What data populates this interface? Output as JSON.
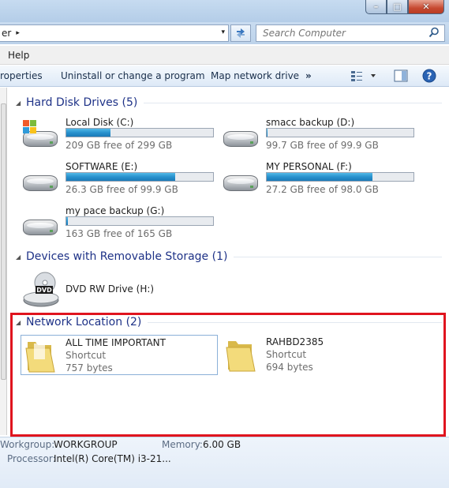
{
  "window": {
    "min_glyph": "–",
    "max_glyph": "□",
    "close_glyph": "✕"
  },
  "address": {
    "text": "er",
    "separator": "▸",
    "dropdown": "▾"
  },
  "search": {
    "placeholder": "Search Computer"
  },
  "menu": {
    "items": [
      "Help"
    ]
  },
  "toolbar": {
    "properties": "roperties",
    "uninstall": "Uninstall or change a program",
    "map_drive": "Map network drive",
    "more": "»"
  },
  "groups": {
    "hdd": {
      "title": "Hard Disk Drives (5)"
    },
    "removable": {
      "title": "Devices with Removable Storage (1)"
    },
    "network": {
      "title": "Network Location (2)"
    }
  },
  "drives": [
    {
      "name": "Local Disk (C:)",
      "free": "209 GB free of 299 GB",
      "used_fraction": 0.3,
      "system": true
    },
    {
      "name": "smacc backup (D:)",
      "free": "99.7 GB free of 99.9 GB",
      "used_fraction": 0.002,
      "system": false
    },
    {
      "name": "SOFTWARE (E:)",
      "free": "26.3 GB free of 99.9 GB",
      "used_fraction": 0.74,
      "system": false
    },
    {
      "name": "MY PERSONAL (F:)",
      "free": "27.2 GB free of 98.0 GB",
      "used_fraction": 0.72,
      "system": false
    },
    {
      "name": "my pace backup (G:)",
      "free": "163 GB free of 165 GB",
      "used_fraction": 0.012,
      "system": false
    }
  ],
  "dvd": {
    "name": "DVD RW Drive (H:)",
    "badge": "DVD"
  },
  "network_items": [
    {
      "name": "ALL TIME IMPORTANT",
      "type": "Shortcut",
      "size": "757 bytes"
    },
    {
      "name": "RAHBD2385",
      "type": "Shortcut",
      "size": "694 bytes"
    }
  ],
  "details": {
    "workgroup_label": "Workgroup:",
    "workgroup_value": "WORKGROUP",
    "memory_label": "Memory:",
    "memory_value": "6.00 GB",
    "processor_label": "Processor:",
    "processor_value": "Intel(R) Core(TM) i3-21..."
  },
  "colors": {
    "accent": "#1e3287",
    "highlight": "#e0141e",
    "bar": "#2891cd"
  }
}
